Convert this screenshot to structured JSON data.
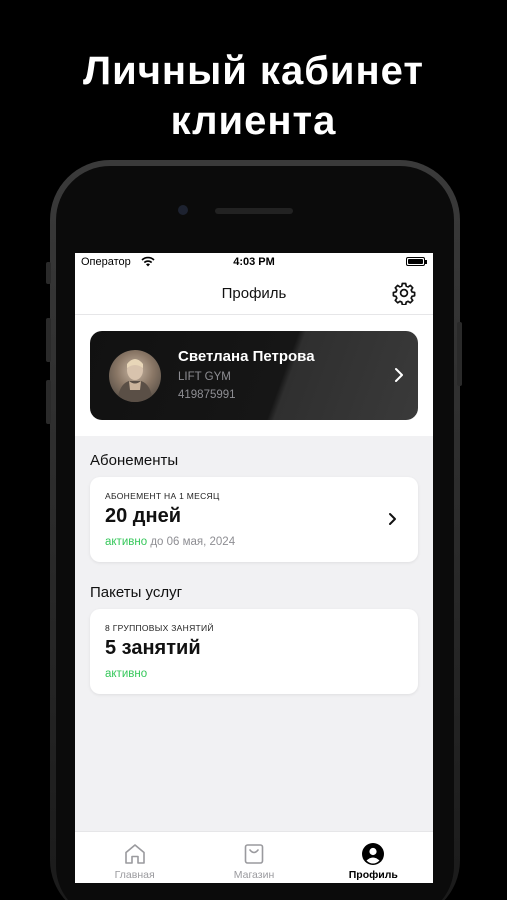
{
  "promo": {
    "line1": "Личный кабинет",
    "line2": "клиента"
  },
  "status_bar": {
    "carrier": "Оператор",
    "time": "4:03 PM"
  },
  "header": {
    "title": "Профиль",
    "settings_icon": "gear-icon"
  },
  "profile": {
    "name": "Светлана Петрова",
    "gym": "LIFT GYM",
    "id": "419875991"
  },
  "memberships": {
    "section_title": "Абонементы",
    "card": {
      "caption": "АБОНЕМЕНТ НА 1 МЕСЯЦ",
      "value": "20 дней",
      "status": "активно",
      "until": "до 06 мая, 2024"
    }
  },
  "packages": {
    "section_title": "Пакеты услуг",
    "card": {
      "caption": "8 ГРУППОВЫХ ЗАНЯТИЙ",
      "value": "5 занятий",
      "status": "активно"
    }
  },
  "tabbar": {
    "items": [
      {
        "label": "Главная",
        "icon": "home-icon",
        "active": false
      },
      {
        "label": "Магазин",
        "icon": "shopping-bag-icon",
        "active": false
      },
      {
        "label": "Профиль",
        "icon": "profile-icon",
        "active": true
      }
    ]
  },
  "colors": {
    "accent_green": "#34c759",
    "card_dark": "#161616",
    "background": "#000000"
  }
}
